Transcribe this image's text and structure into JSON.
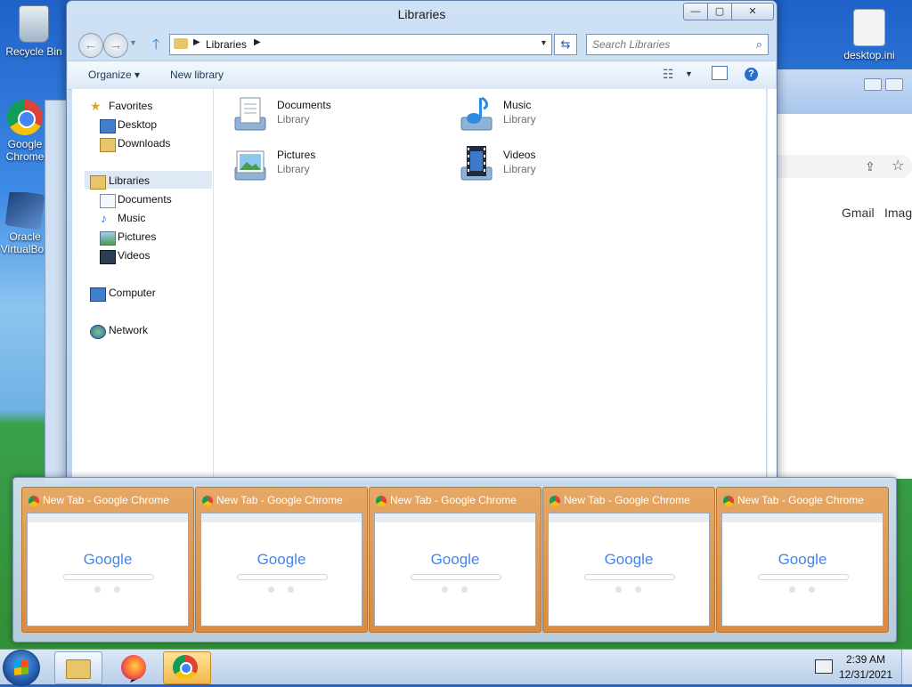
{
  "desktop": {
    "icons": [
      {
        "label": "Recycle Bin"
      },
      {
        "label": "Google Chrome"
      },
      {
        "label": "Oracle VirtualBox"
      },
      {
        "label": "desktop.ini"
      }
    ]
  },
  "background_chrome": {
    "links": {
      "gmail": "Gmail",
      "images": "Images"
    }
  },
  "explorer": {
    "title": "Libraries",
    "window_controls": {
      "minimize": "—",
      "maximize": "▢",
      "close": "✕"
    },
    "address": {
      "path": [
        "Libraries"
      ]
    },
    "search": {
      "placeholder": "Search Libraries"
    },
    "toolbar": {
      "organize": "Organize",
      "new_library": "New library"
    },
    "nav": {
      "favorites": {
        "label": "Favorites",
        "items": [
          "Desktop",
          "Downloads"
        ]
      },
      "libraries": {
        "label": "Libraries",
        "items": [
          "Documents",
          "Music",
          "Pictures",
          "Videos"
        ]
      },
      "computer": "Computer",
      "network": "Network"
    },
    "libraries": [
      {
        "name": "Documents",
        "type": "Library",
        "icon": "documents-library-icon"
      },
      {
        "name": "Music",
        "type": "Library",
        "icon": "music-library-icon"
      },
      {
        "name": "Pictures",
        "type": "Library",
        "icon": "pictures-library-icon"
      },
      {
        "name": "Videos",
        "type": "Library",
        "icon": "videos-library-icon"
      }
    ]
  },
  "thumbnails": [
    {
      "title": "New Tab - Google Chrome",
      "logo": "Google"
    },
    {
      "title": "New Tab - Google Chrome",
      "logo": "Google"
    },
    {
      "title": "New Tab - Google Chrome",
      "logo": "Google"
    },
    {
      "title": "New Tab - Google Chrome",
      "logo": "Google"
    },
    {
      "title": "New Tab - Google Chrome",
      "logo": "Google"
    }
  ],
  "taskbar": {
    "items": [
      "explorer",
      "firefox",
      "chrome"
    ],
    "clock": {
      "time": "2:39 AM",
      "date": "12/31/2021"
    }
  },
  "colors": {
    "thumbnail_highlight": "#e09a55",
    "selection": "#dfe9f6",
    "help_blue": "#2a6fc7"
  }
}
